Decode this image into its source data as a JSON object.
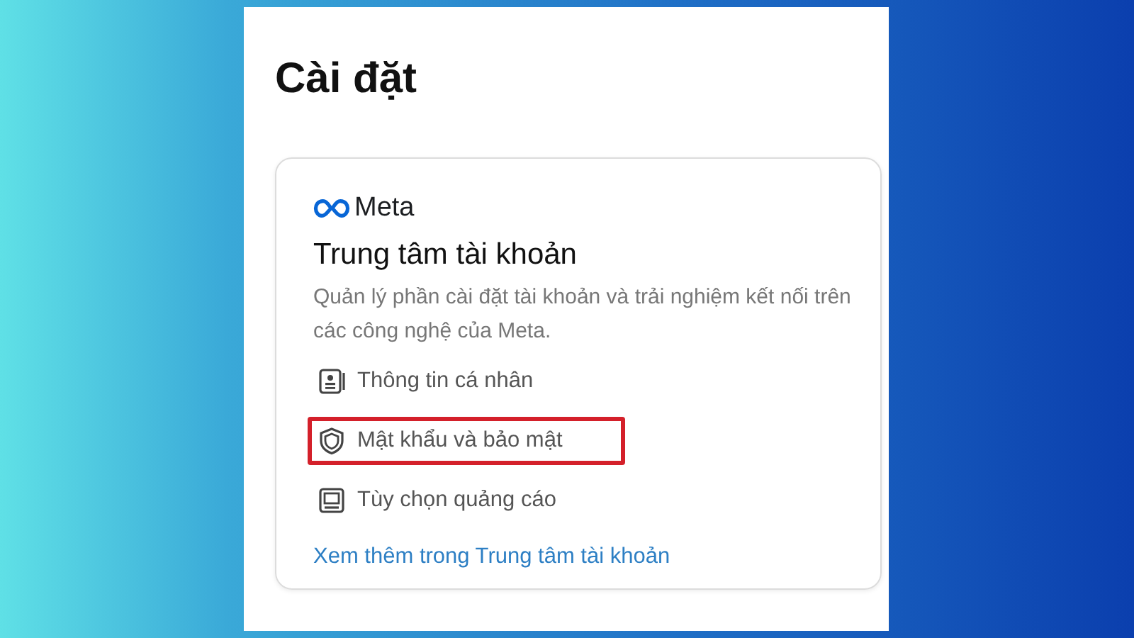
{
  "page": {
    "title": "Cài đặt"
  },
  "card": {
    "brand": "Meta",
    "heading": "Trung tâm tài khoản",
    "description": "Quản lý phần cài đặt tài khoản và trải nghiệm kết nối trên các công nghệ của Meta.",
    "items": [
      {
        "kind": "profile",
        "label": "Thông tin cá nhân",
        "highlighted": false
      },
      {
        "kind": "security",
        "label": "Mật khẩu và bảo mật",
        "highlighted": true
      },
      {
        "kind": "ads",
        "label": "Tùy chọn quảng cáo",
        "highlighted": false
      }
    ],
    "link": "Xem thêm trong Trung tâm tài khoản"
  }
}
